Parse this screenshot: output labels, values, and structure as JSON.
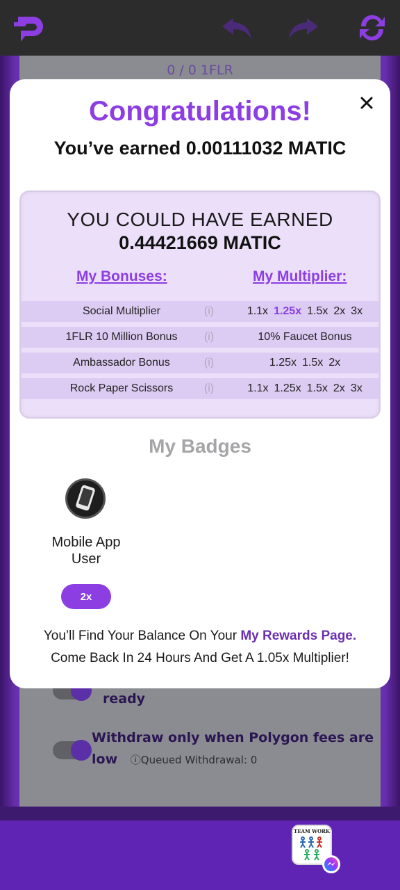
{
  "colors": {
    "accent": "#8c3ee3",
    "topbar": "#2c2c2c",
    "bottombar": "#5f24b3"
  },
  "background": {
    "balance_text": "0 / 0 1FLR",
    "ready_text": "ready",
    "withdraw_text_1": "Withdraw only when Polygon fees are",
    "withdraw_text_2": "low",
    "queued_text": "Queued Withdrawal: 0"
  },
  "bottombar": {
    "teamwork_title": "TEAM WORK"
  },
  "modal": {
    "title": "Congratulations!",
    "earned_prefix": "You’ve earned",
    "earned_amount": "0.00111032 MATIC",
    "could_title": "YOU COULD HAVE EARNED",
    "could_amount": "0.44421669 MATIC",
    "bonuses_header": "My Bonuses:",
    "multiplier_header": "My Multiplier:",
    "bonuses": [
      {
        "name": "Social Multiplier",
        "info": "(i)",
        "multipliers": [
          "1.1x",
          "1.25x",
          "1.5x",
          "2x",
          "3x"
        ],
        "active_index": 1
      },
      {
        "name": "1FLR 10 Million Bonus",
        "info": "(i)",
        "multipliers": [
          "10% Faucet Bonus"
        ],
        "active_index": -1
      },
      {
        "name": "Ambassador Bonus",
        "info": "(i)",
        "multipliers": [
          "1.25x",
          "1.5x",
          "2x"
        ],
        "active_index": -1
      },
      {
        "name": "Rock Paper Scissors",
        "info": "(i)",
        "multipliers": [
          "1.1x",
          "1.25x",
          "1.5x",
          "2x",
          "3x"
        ],
        "active_index": -1
      }
    ],
    "badges_title": "My Badges",
    "badge": {
      "icon": "smartphone-icon",
      "label_1": "Mobile App",
      "label_2": "User",
      "multiplier": "2x"
    },
    "footer_1_prefix": "You’ll Find Your Balance On Your",
    "footer_1_link": "My Rewards Page.",
    "footer_2": "Come Back In 24 Hours And Get A 1.05x Multiplier!"
  }
}
